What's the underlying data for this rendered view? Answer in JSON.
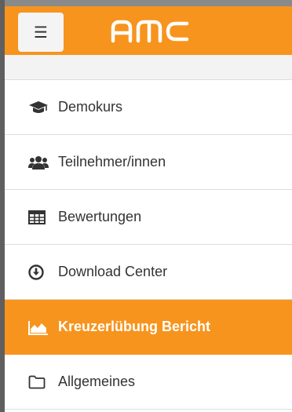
{
  "header": {
    "brand": "AMC",
    "menu_toggle_glyph": "☰",
    "bar_color": "#f7941d"
  },
  "nav": {
    "items": [
      {
        "label": "Demokurs",
        "icon": "graduation-cap-icon",
        "active": false
      },
      {
        "label": "Teilnehmer/innen",
        "icon": "users-icon",
        "active": false
      },
      {
        "label": "Bewertungen",
        "icon": "table-icon",
        "active": false
      },
      {
        "label": "Download Center",
        "icon": "download-circle-icon",
        "active": false
      },
      {
        "label": "Kreuzerlübung Bericht",
        "icon": "area-chart-icon",
        "active": true
      },
      {
        "label": "Allgemeines",
        "icon": "folder-icon",
        "active": false
      }
    ]
  },
  "colors": {
    "accent": "#f7941d",
    "text": "#333333",
    "active_text": "#ffffff"
  }
}
